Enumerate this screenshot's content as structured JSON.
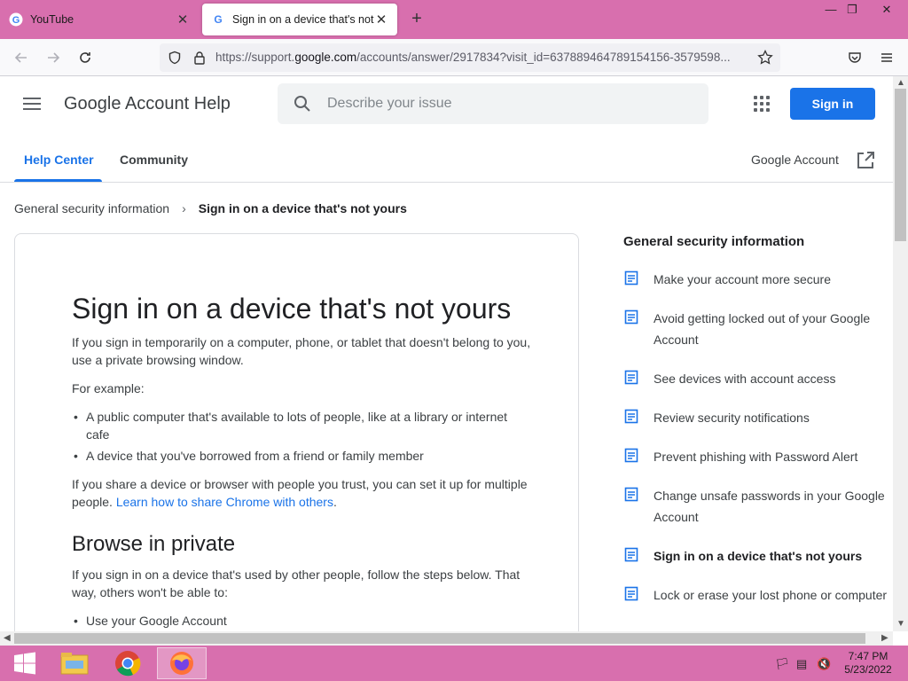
{
  "browser": {
    "tabs": [
      {
        "title": "YouTube",
        "active": false
      },
      {
        "title": "Sign in on a device that's not yours",
        "active": true
      }
    ],
    "url_prefix": "https://support.",
    "url_domain": "google.com",
    "url_rest": "/accounts/answer/2917834?visit_id=637889464789154156-3579598..."
  },
  "header": {
    "brand": "Google Account Help",
    "search_placeholder": "Describe your issue",
    "signin_label": "Sign in",
    "tabs": [
      "Help Center",
      "Community"
    ],
    "google_account_label": "Google Account"
  },
  "breadcrumb": {
    "parent": "General security information",
    "current": "Sign in on a device that's not yours"
  },
  "article": {
    "title": "Sign in on a device that's not yours",
    "intro": "If you sign in temporarily on a computer, phone, or tablet that doesn't belong to you, use a private browsing window.",
    "example_label": "For example:",
    "examples": [
      "A public computer that's available to lots of people, like at a library or internet cafe",
      "A device that you've borrowed from a friend or family member"
    ],
    "share_text": "If you share a device or browser with people you trust, you can set it up for multiple people. ",
    "share_link": "Learn how to share Chrome with others",
    "share_end": ".",
    "section_title": "Browse in private",
    "section_text": "If you sign in on a device that's used by other people, follow the steps below. That way, others won't be able to:",
    "section_items": [
      "Use your Google Account"
    ]
  },
  "sidebar": {
    "title": "General security information",
    "items": [
      "Make your account more secure",
      "Avoid getting locked out of your Google Account",
      "See devices with account access",
      "Review security notifications",
      "Prevent phishing with Password Alert",
      "Change unsafe passwords in your Google Account",
      "Sign in on a device that's not yours",
      "Lock or erase your lost phone or computer"
    ],
    "current_index": 6
  },
  "taskbar": {
    "time": "7:47 PM",
    "date": "5/23/2022"
  },
  "colors": {
    "accent": "#1a73e8",
    "chrome_frame": "#d86fae"
  }
}
